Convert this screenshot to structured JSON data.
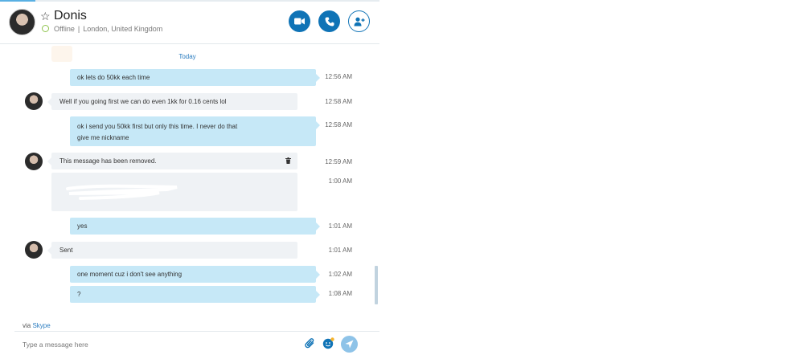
{
  "contact": {
    "name": "Donis",
    "status": "Offline",
    "location": "London, United Kingdom"
  },
  "chat": {
    "date_divider": "Today",
    "messages": [
      {
        "text": "ok lets do 50kk each time",
        "time": "12:56 AM"
      },
      {
        "text": "Well if you going first we can do even 1kk for 0.16 cents lol",
        "time": "12:58 AM"
      },
      {
        "text": "ok i send you 50kk first but only this time. I never do that",
        "text2": "give me nickname",
        "time": "12:58 AM"
      },
      {
        "text": "This message has been removed.",
        "time": "12:59 AM"
      },
      {
        "text": "",
        "time": "1:00 AM"
      },
      {
        "text": "yes",
        "time": "1:01 AM"
      },
      {
        "text": "Sent",
        "time": "1:01 AM"
      },
      {
        "text": "one moment cuz i don't see anything",
        "time": "1:02 AM"
      },
      {
        "text": "?",
        "time": "1:08 AM"
      }
    ]
  },
  "composer": {
    "via_prefix": "via",
    "via_link": "Skype",
    "placeholder": "Type a message here"
  },
  "colors": {
    "accent": "#0f73b6",
    "outgoing_bubble": "#c6e8f7",
    "incoming_bubble": "#eff2f5",
    "link": "#2a7cc0"
  }
}
